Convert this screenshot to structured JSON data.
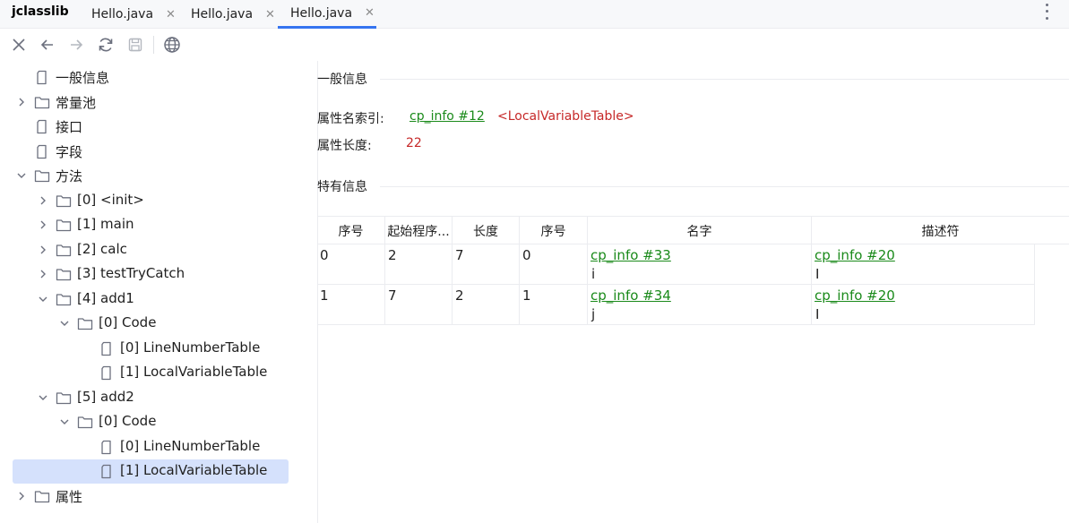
{
  "app": {
    "title": "jclasslib"
  },
  "tabs": [
    {
      "label": "Hello.java",
      "active": false
    },
    {
      "label": "Hello.java",
      "active": false
    },
    {
      "label": "Hello.java",
      "active": true
    }
  ],
  "toolbar": {
    "icons": [
      "close-icon",
      "back-arrow-icon",
      "forward-arrow-icon",
      "refresh-icon",
      "save-icon",
      "web-icon"
    ]
  },
  "tree": {
    "items": [
      {
        "label": "一般信息",
        "type": "file",
        "expandable": false
      },
      {
        "label": "常量池",
        "type": "folder",
        "expandable": true,
        "expanded": false
      },
      {
        "label": "接口",
        "type": "file",
        "expandable": false
      },
      {
        "label": "字段",
        "type": "file",
        "expandable": false
      },
      {
        "label": "方法",
        "type": "folder",
        "expandable": true,
        "expanded": true
      },
      {
        "label": "[0] <init>",
        "type": "folder",
        "expandable": true,
        "expanded": false
      },
      {
        "label": "[1] main",
        "type": "folder",
        "expandable": true,
        "expanded": false
      },
      {
        "label": "[2] calc",
        "type": "folder",
        "expandable": true,
        "expanded": false
      },
      {
        "label": "[3] testTryCatch",
        "type": "folder",
        "expandable": true,
        "expanded": false
      },
      {
        "label": "[4] add1",
        "type": "folder",
        "expandable": true,
        "expanded": true
      },
      {
        "label": "[0] Code",
        "type": "folder",
        "expandable": true,
        "expanded": true
      },
      {
        "label": "[0] LineNumberTable",
        "type": "file",
        "expandable": false
      },
      {
        "label": "[1] LocalVariableTable",
        "type": "file",
        "expandable": false
      },
      {
        "label": "[5] add2",
        "type": "folder",
        "expandable": true,
        "expanded": true
      },
      {
        "label": "[0] Code",
        "type": "folder",
        "expandable": true,
        "expanded": true
      },
      {
        "label": "[0] LineNumberTable",
        "type": "file",
        "expandable": false
      },
      {
        "label": "[1] LocalVariableTable",
        "type": "file",
        "expandable": false,
        "selected": true
      },
      {
        "label": "属性",
        "type": "folder",
        "expandable": true,
        "expanded": false
      }
    ]
  },
  "general": {
    "section_title": "一般信息",
    "name_index_label": "属性名索引:",
    "name_index_link": "cp_info #12",
    "name_index_value": "<LocalVariableTable>",
    "length_label": "属性长度:",
    "length_value": "22"
  },
  "specific": {
    "section_title": "特有信息",
    "columns": [
      "序号",
      "起始程序...",
      "长度",
      "序号",
      "名字",
      "描述符"
    ],
    "rows": [
      {
        "index": "0",
        "start_pc": "2",
        "length": "7",
        "slot": "0",
        "name_link": "cp_info #33",
        "name_value": "i",
        "desc_link": "cp_info #20",
        "desc_value": "I"
      },
      {
        "index": "1",
        "start_pc": "7",
        "length": "2",
        "slot": "1",
        "name_link": "cp_info #34",
        "name_value": "j",
        "desc_link": "cp_info #20",
        "desc_value": "I"
      }
    ]
  },
  "colors": {
    "accent": "#3574f0",
    "link": "#1a8a1a",
    "value": "#c62828",
    "selection": "#d5e1fc"
  }
}
